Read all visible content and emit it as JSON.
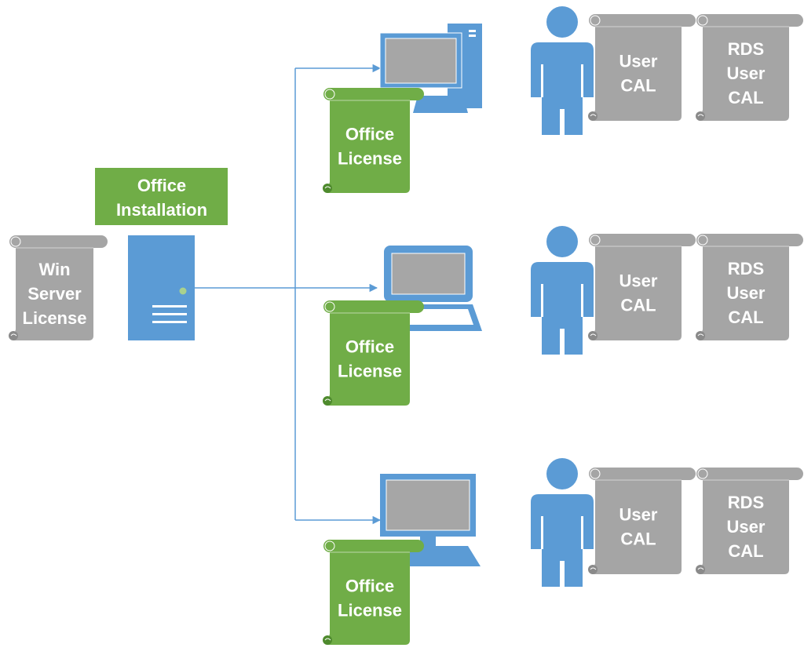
{
  "colors": {
    "blue": "#5B9BD5",
    "green": "#70AD47",
    "gray": "#A5A5A5",
    "screen_gray": "#A6A6A6",
    "led_green": "#A9D18E",
    "connector": "#5B9BD5"
  },
  "server": {
    "install_label": [
      "Office",
      "Installation"
    ],
    "license_label": [
      "Win",
      "Server",
      "License"
    ],
    "icon": "server-icon"
  },
  "clients": [
    {
      "device": "desktop-icon",
      "license_label": [
        "Office",
        "License"
      ],
      "user_icon": "user-icon",
      "cals": [
        [
          "User",
          "CAL"
        ],
        [
          "RDS",
          "User",
          "CAL"
        ]
      ]
    },
    {
      "device": "laptop-icon",
      "license_label": [
        "Office",
        "License"
      ],
      "user_icon": "user-icon",
      "cals": [
        [
          "User",
          "CAL"
        ],
        [
          "RDS",
          "User",
          "CAL"
        ]
      ]
    },
    {
      "device": "monitor-keyboard-icon",
      "license_label": [
        "Office",
        "License"
      ],
      "user_icon": "user-icon",
      "cals": [
        [
          "User",
          "CAL"
        ],
        [
          "RDS",
          "User",
          "CAL"
        ]
      ]
    }
  ]
}
